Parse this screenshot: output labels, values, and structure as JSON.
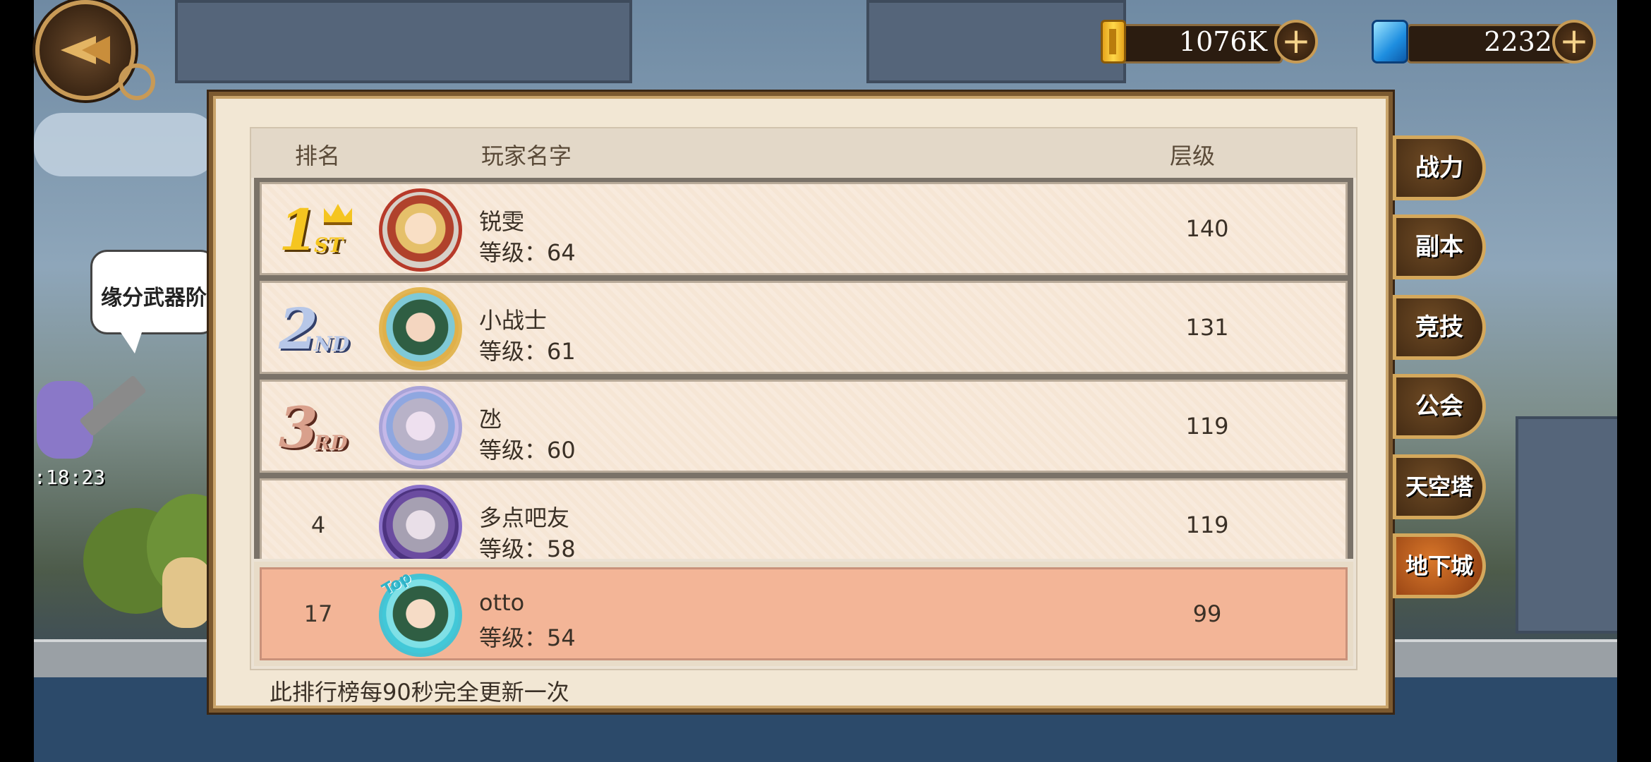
{
  "currency": {
    "gold": "1076K",
    "gems": "2232"
  },
  "scene": {
    "bubble_text": "缘分武器阶",
    "timer": ":18:23"
  },
  "leaderboard": {
    "headers": {
      "rank": "排名",
      "name": "玩家名字",
      "floor": "层级"
    },
    "rows": [
      {
        "rank": "1",
        "rank_suffix": "ST",
        "name": "锐雯",
        "level": "等级：64",
        "floor": "140"
      },
      {
        "rank": "2",
        "rank_suffix": "ND",
        "name": "小战士",
        "level": "等级：61",
        "floor": "131"
      },
      {
        "rank": "3",
        "rank_suffix": "RD",
        "name": "氹",
        "level": "等级：60",
        "floor": "119"
      },
      {
        "rank": "4",
        "rank_suffix": "",
        "name": "多点吧友",
        "level": "等级：58",
        "floor": "119"
      }
    ],
    "me": {
      "rank": "17",
      "name": "otto",
      "level": "等级：54",
      "floor": "99",
      "avatar_badge": "Top"
    },
    "footer": "此排行榜每90秒完全更新一次"
  },
  "tabs": [
    "战力",
    "副本",
    "竞技",
    "公会",
    "天空塔",
    "地下城"
  ],
  "active_tab": "地下城",
  "colors": {
    "panel": "#f2e7d4",
    "my_row": "#f3b597",
    "tab_active": "#d9772a",
    "tab_border": "#d4a85c"
  }
}
